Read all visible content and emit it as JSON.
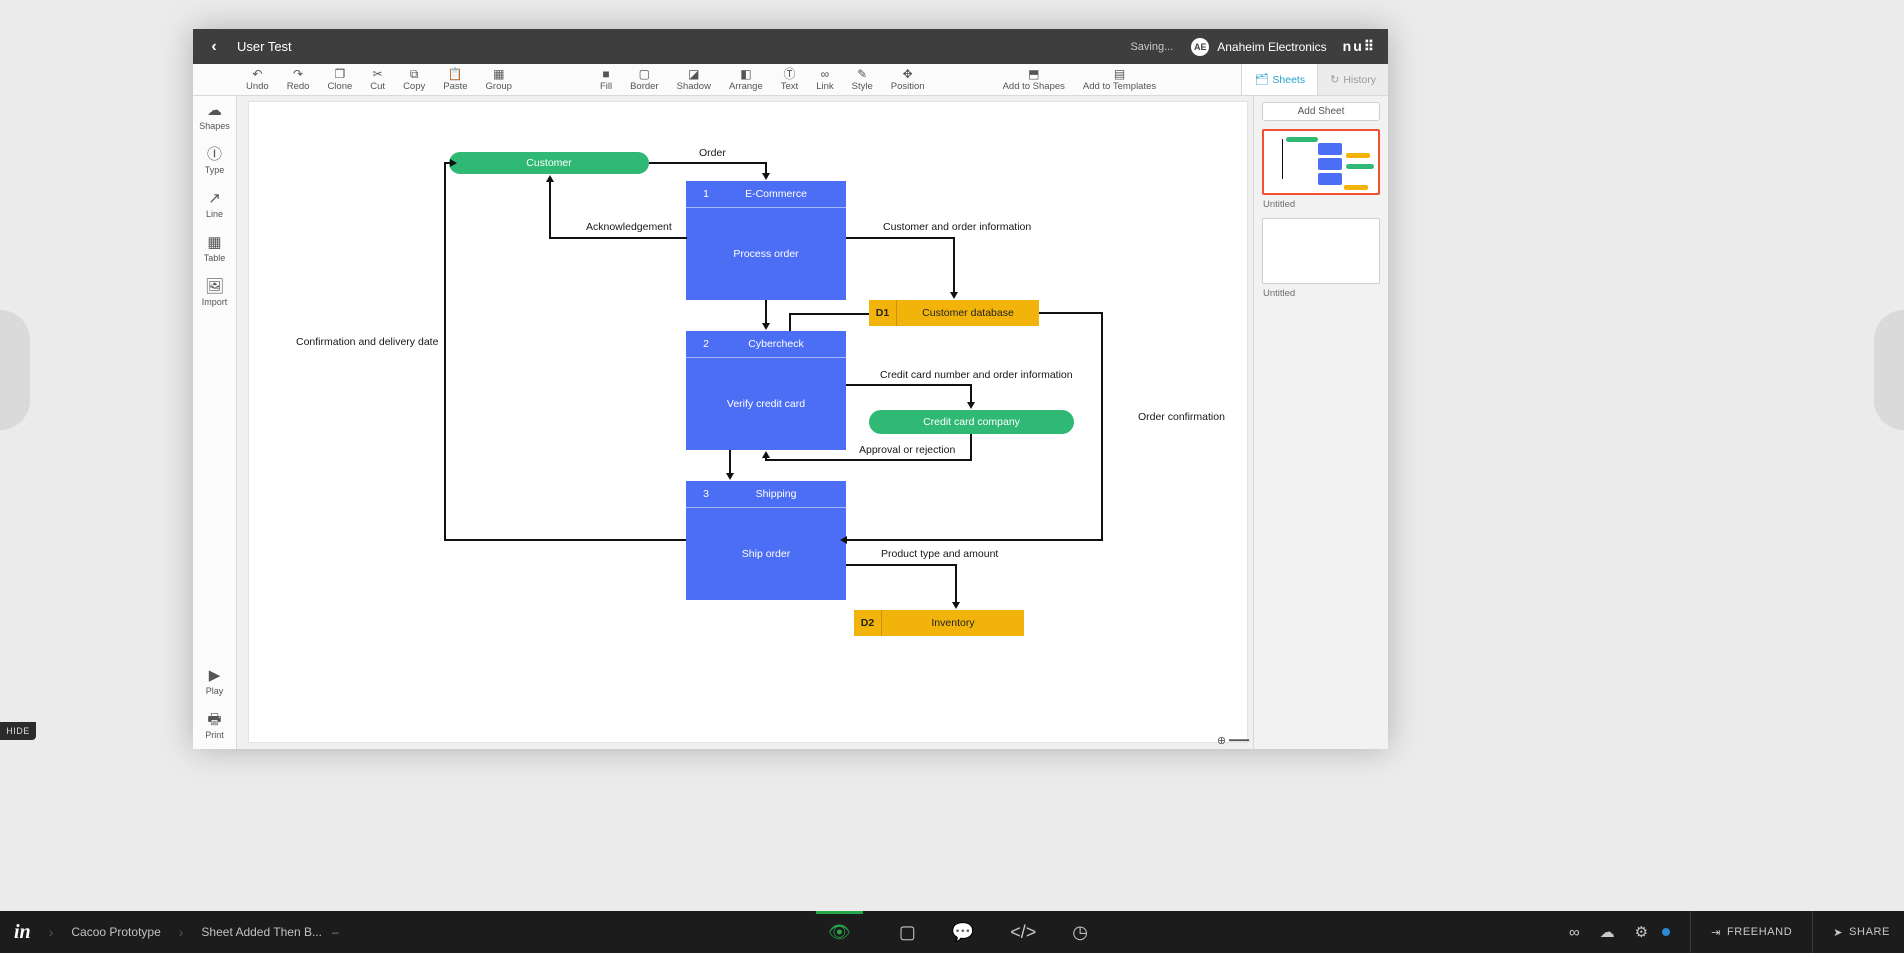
{
  "header": {
    "title": "User Test",
    "saving": "Saving...",
    "user_initials": "AE",
    "user": "Anaheim Electronics",
    "logo": "nu⠿"
  },
  "toolbar": {
    "undo": "Undo",
    "redo": "Redo",
    "clone": "Clone",
    "cut": "Cut",
    "copy": "Copy",
    "paste": "Paste",
    "group": "Group",
    "fill": "Fill",
    "border": "Border",
    "shadow": "Shadow",
    "arrange": "Arrange",
    "text": "Text",
    "link": "Link",
    "style": "Style",
    "position": "Position",
    "add_shapes": "Add to Shapes",
    "add_templates": "Add to Templates"
  },
  "right_tabs": {
    "sheets": "Sheets",
    "history": "History"
  },
  "sidebar": {
    "shapes": "Shapes",
    "type": "Type",
    "line": "Line",
    "table": "Table",
    "import": "Import",
    "play": "Play",
    "print": "Print"
  },
  "right_panel": {
    "add_sheet": "Add Sheet",
    "sheet1_title": "Untitled",
    "sheet2_title": "Untitled"
  },
  "diagram": {
    "customer": "Customer",
    "order": "Order",
    "ecommerce_num": "1",
    "ecommerce": "E-Commerce",
    "process_order": "Process order",
    "ack": "Acknowledgement",
    "cust_order_info": "Customer and order information",
    "conf_delivery": "Confirmation and delivery date",
    "d1_id": "D1",
    "d1_name": "Customer database",
    "cyber_num": "2",
    "cyber": "Cybercheck",
    "verify": "Verify credit card",
    "cc_info": "Credit card number and order information",
    "cc_company": "Credit card company",
    "approval": "Approval or rejection",
    "order_conf": "Order confirmation",
    "ship_num": "3",
    "ship": "Shipping",
    "ship_order": "Ship order",
    "prod_type": "Product type and amount",
    "d2_id": "D2",
    "d2_name": "Inventory"
  },
  "inv": {
    "crumb1": "Cacoo Prototype",
    "crumb2": "Sheet Added Then B...",
    "dash": "–",
    "freehand": "FREEHAND",
    "share": "SHARE"
  },
  "hide": "HIDE"
}
